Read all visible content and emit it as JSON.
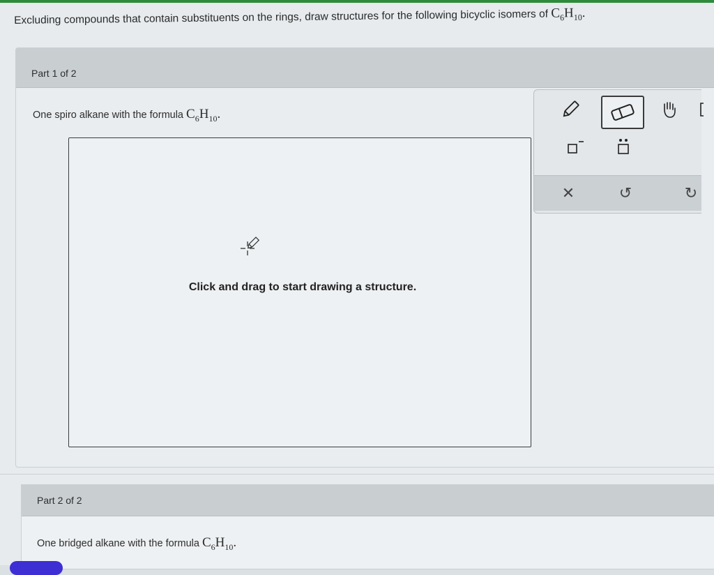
{
  "question": {
    "text": "Excluding compounds that contain substituents on the rings, draw structures for the following bicyclic isomers of",
    "formula_main": "C",
    "formula_sub1": "6",
    "formula_h": "H",
    "formula_sub2": "10",
    "formula_end": "."
  },
  "part1": {
    "label": "Part 1 of 2",
    "prompt": "One spiro alkane with the formula",
    "formula_c": "C",
    "formula_sub1": "6",
    "formula_h": "H",
    "formula_sub2": "10",
    "formula_end": ".",
    "hint": "Click and drag to start drawing a structure."
  },
  "toolbox": {
    "tools": [
      "pencil-icon",
      "eraser-icon",
      "hand-icon",
      "bracket-icon",
      "charge-icon",
      "lone-pair-icon"
    ],
    "actions": [
      "clear-icon",
      "undo-icon",
      "redo-icon"
    ],
    "clear_glyph": "✕",
    "undo_glyph": "↺",
    "redo_glyph": "↻"
  },
  "part2": {
    "label": "Part 2 of 2",
    "prompt": "One bridged alkane with the formula",
    "formula_c": "C",
    "formula_sub1": "6",
    "formula_h": "H",
    "formula_sub2": "10",
    "formula_end": "."
  },
  "colors": {
    "top_bar": "#2e8b3c",
    "header": "#c9ced1",
    "pill": "#3d2fd4"
  }
}
